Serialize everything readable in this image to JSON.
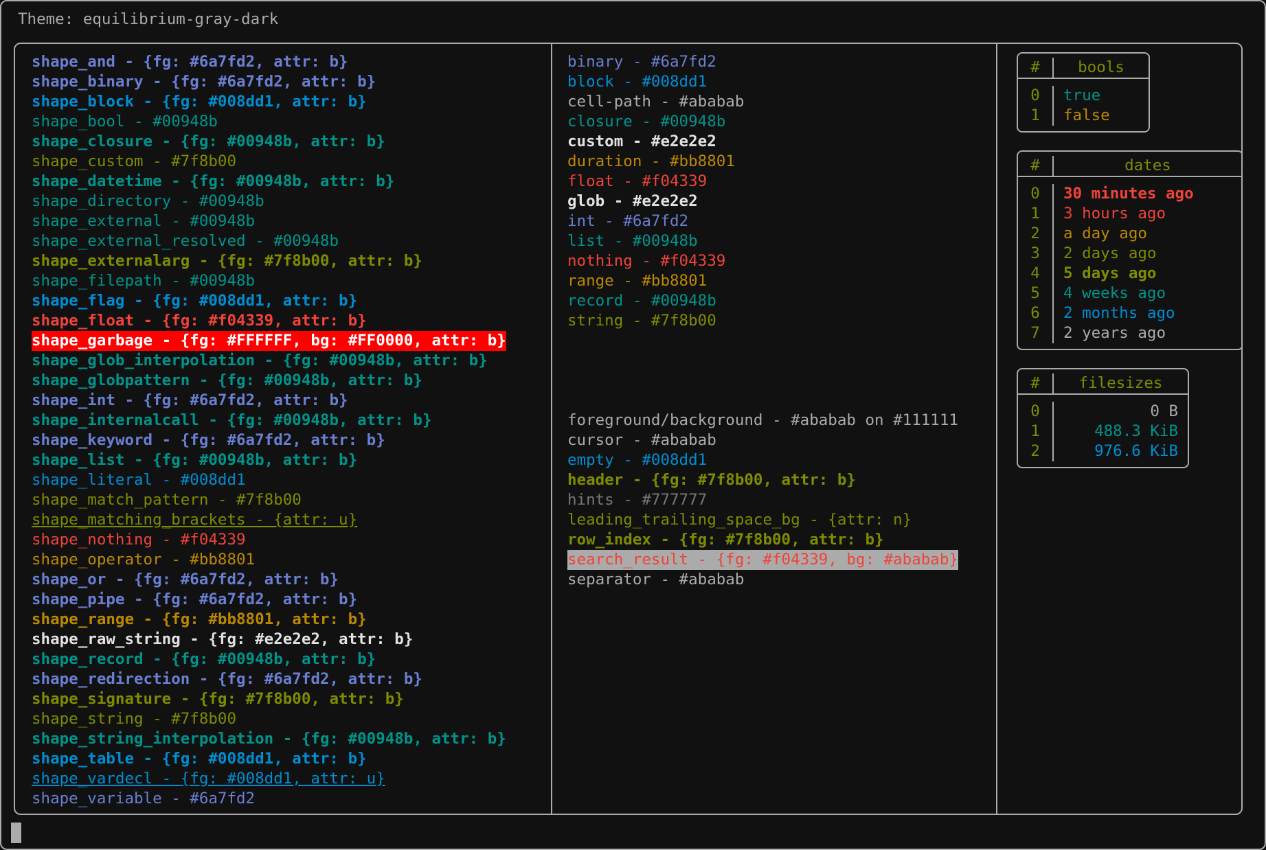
{
  "title": "Theme: equilibrium-gray-dark",
  "palette": {
    "background": "#111111",
    "foreground": "#ababab",
    "blue": "#6a7fd2",
    "cyan": "#008dd1",
    "teal": "#00948b",
    "olive": "#7f8b00",
    "orange": "#bb8801",
    "red": "#f04339",
    "white": "#e2e2e2",
    "hint": "#777777",
    "garbage_bg": "#FF0000",
    "garbage_fg": "#FFFFFF",
    "search_result_bg": "#ababab"
  },
  "shapes": [
    {
      "text": "shape_and - {fg: #6a7fd2, attr: b}",
      "color": "blue",
      "bold": true
    },
    {
      "text": "shape_binary - {fg: #6a7fd2, attr: b}",
      "color": "blue",
      "bold": true
    },
    {
      "text": "shape_block - {fg: #008dd1, attr: b}",
      "color": "cyan",
      "bold": true
    },
    {
      "text": "shape_bool - #00948b",
      "color": "teal",
      "bold": false
    },
    {
      "text": "shape_closure - {fg: #00948b, attr: b}",
      "color": "teal",
      "bold": true
    },
    {
      "text": "shape_custom - #7f8b00",
      "color": "olive",
      "bold": false
    },
    {
      "text": "shape_datetime - {fg: #00948b, attr: b}",
      "color": "teal",
      "bold": true
    },
    {
      "text": "shape_directory - #00948b",
      "color": "teal",
      "bold": false
    },
    {
      "text": "shape_external - #00948b",
      "color": "teal",
      "bold": false
    },
    {
      "text": "shape_external_resolved - #00948b",
      "color": "teal",
      "bold": false
    },
    {
      "text": "shape_externalarg - {fg: #7f8b00, attr: b}",
      "color": "olive",
      "bold": true
    },
    {
      "text": "shape_filepath - #00948b",
      "color": "teal",
      "bold": false
    },
    {
      "text": "shape_flag - {fg: #008dd1, attr: b}",
      "color": "cyan",
      "bold": true
    },
    {
      "text": "shape_float - {fg: #f04339, attr: b}",
      "color": "red",
      "bold": true
    },
    {
      "text": "shape_garbage - {fg: #FFFFFF, bg: #FF0000, attr: b}",
      "color": "garbage",
      "bold": true
    },
    {
      "text": "shape_glob_interpolation - {fg: #00948b, attr: b}",
      "color": "teal",
      "bold": true
    },
    {
      "text": "shape_globpattern - {fg: #00948b, attr: b}",
      "color": "teal",
      "bold": true
    },
    {
      "text": "shape_int - {fg: #6a7fd2, attr: b}",
      "color": "blue",
      "bold": true
    },
    {
      "text": "shape_internalcall - {fg: #00948b, attr: b}",
      "color": "teal",
      "bold": true
    },
    {
      "text": "shape_keyword - {fg: #6a7fd2, attr: b}",
      "color": "blue",
      "bold": true
    },
    {
      "text": "shape_list - {fg: #00948b, attr: b}",
      "color": "teal",
      "bold": true
    },
    {
      "text": "shape_literal - #008dd1",
      "color": "cyan",
      "bold": false
    },
    {
      "text": "shape_match_pattern - #7f8b00",
      "color": "olive",
      "bold": false
    },
    {
      "text": "shape_matching_brackets - {attr: u}",
      "color": "olive",
      "bold": false,
      "underline": true
    },
    {
      "text": "shape_nothing - #f04339",
      "color": "red",
      "bold": false
    },
    {
      "text": "shape_operator - #bb8801",
      "color": "orange",
      "bold": false
    },
    {
      "text": "shape_or - {fg: #6a7fd2, attr: b}",
      "color": "blue",
      "bold": true
    },
    {
      "text": "shape_pipe - {fg: #6a7fd2, attr: b}",
      "color": "blue",
      "bold": true
    },
    {
      "text": "shape_range - {fg: #bb8801, attr: b}",
      "color": "orange",
      "bold": true
    },
    {
      "text": "shape_raw_string - {fg: #e2e2e2, attr: b}",
      "color": "white",
      "bold": true
    },
    {
      "text": "shape_record - {fg: #00948b, attr: b}",
      "color": "teal",
      "bold": true
    },
    {
      "text": "shape_redirection - {fg: #6a7fd2, attr: b}",
      "color": "blue",
      "bold": true
    },
    {
      "text": "shape_signature - {fg: #7f8b00, attr: b}",
      "color": "olive",
      "bold": true
    },
    {
      "text": "shape_string - #7f8b00",
      "color": "olive",
      "bold": false
    },
    {
      "text": "shape_string_interpolation - {fg: #00948b, attr: b}",
      "color": "teal",
      "bold": true
    },
    {
      "text": "shape_table - {fg: #008dd1, attr: b}",
      "color": "cyan",
      "bold": true
    },
    {
      "text": "shape_vardecl - {fg: #008dd1, attr: u}",
      "color": "cyan",
      "bold": false,
      "underline": true
    },
    {
      "text": "shape_variable - #6a7fd2",
      "color": "blue",
      "bold": false
    }
  ],
  "types": [
    {
      "text": "binary - #6a7fd2",
      "color": "blue",
      "bold": false
    },
    {
      "text": "block - #008dd1",
      "color": "cyan",
      "bold": false
    },
    {
      "text": "cell-path - #ababab",
      "color": "fg",
      "bold": false
    },
    {
      "text": "closure - #00948b",
      "color": "teal",
      "bold": false
    },
    {
      "text": "custom - #e2e2e2",
      "color": "white",
      "bold": true
    },
    {
      "text": "duration - #bb8801",
      "color": "orange",
      "bold": false
    },
    {
      "text": "float - #f04339",
      "color": "red",
      "bold": false
    },
    {
      "text": "glob - #e2e2e2",
      "color": "white",
      "bold": true
    },
    {
      "text": "int - #6a7fd2",
      "color": "blue",
      "bold": false
    },
    {
      "text": "list - #00948b",
      "color": "teal",
      "bold": false
    },
    {
      "text": "nothing - #f04339",
      "color": "red",
      "bold": false
    },
    {
      "text": "range - #bb8801",
      "color": "orange",
      "bold": false
    },
    {
      "text": "record - #00948b",
      "color": "teal",
      "bold": false
    },
    {
      "text": "string - #7f8b00",
      "color": "olive",
      "bold": false
    }
  ],
  "ui_elements": [
    {
      "text": "foreground/background - #ababab on #111111",
      "color": "fg",
      "bold": false
    },
    {
      "text": "cursor - #ababab",
      "color": "fg",
      "bold": false
    },
    {
      "text": "empty - #008dd1",
      "color": "cyan",
      "bold": false
    },
    {
      "text": "header - {fg: #7f8b00, attr: b}",
      "color": "olive",
      "bold": true
    },
    {
      "text": "hints - #777777",
      "color": "hint",
      "bold": false
    },
    {
      "text": "leading_trailing_space_bg - {attr: n}",
      "color": "olive",
      "bold": false
    },
    {
      "text": "row_index - {fg: #7f8b00, attr: b}",
      "color": "olive",
      "bold": true
    },
    {
      "text": "search_result - {fg: #f04339, bg: #ababab}",
      "color": "search",
      "bold": false
    },
    {
      "text": "separator - #ababab",
      "color": "fg",
      "bold": false
    }
  ],
  "tables": [
    {
      "id": "bools",
      "index_header": "#",
      "value_header": "bools",
      "rows": [
        {
          "index": "0",
          "value": "true",
          "color": "teal",
          "bold": false
        },
        {
          "index": "1",
          "value": "false",
          "color": "orange",
          "bold": false
        }
      ]
    },
    {
      "id": "dates",
      "index_header": "#",
      "value_header": "dates",
      "rows": [
        {
          "index": "0",
          "value": "30 minutes ago",
          "color": "red",
          "bold": true
        },
        {
          "index": "1",
          "value": "3 hours ago",
          "color": "red",
          "bold": false
        },
        {
          "index": "2",
          "value": "a day ago",
          "color": "orange",
          "bold": false
        },
        {
          "index": "3",
          "value": "2 days ago",
          "color": "olive",
          "bold": false
        },
        {
          "index": "4",
          "value": "5 days ago",
          "color": "olive",
          "bold": true
        },
        {
          "index": "5",
          "value": "4 weeks ago",
          "color": "teal",
          "bold": false
        },
        {
          "index": "6",
          "value": "2 months ago",
          "color": "cyan",
          "bold": false
        },
        {
          "index": "7",
          "value": "2 years ago",
          "color": "fg",
          "bold": false
        }
      ]
    },
    {
      "id": "filesizes",
      "index_header": "#",
      "value_header": "filesizes",
      "rows": [
        {
          "index": "0",
          "value": "0 B",
          "color": "fg",
          "bold": false
        },
        {
          "index": "1",
          "value": "488.3 KiB",
          "color": "teal",
          "bold": false
        },
        {
          "index": "2",
          "value": "976.6 KiB",
          "color": "cyan",
          "bold": false
        }
      ]
    }
  ]
}
